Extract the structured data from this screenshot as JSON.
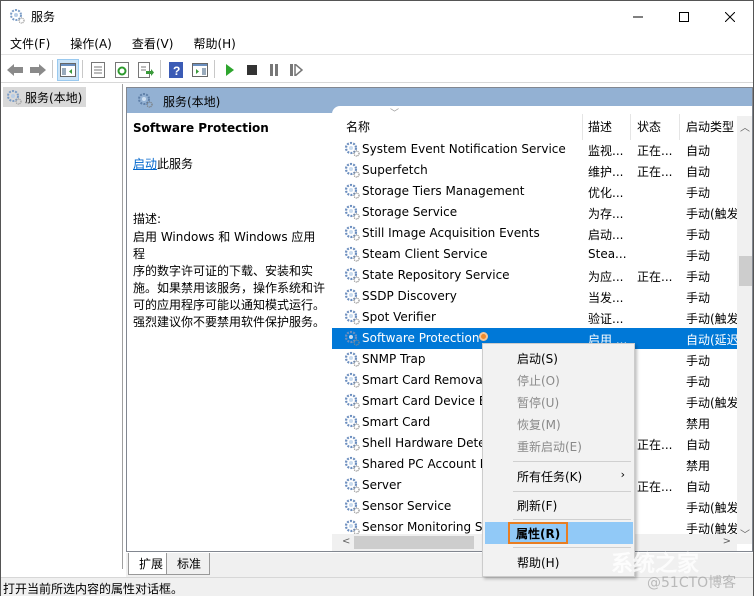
{
  "window": {
    "title": "服务",
    "app_icon": "gear-services-icon",
    "controls": {
      "minimize": "minimize-icon",
      "maximize": "maximize-icon",
      "close": "close-icon"
    }
  },
  "menubar": {
    "items": [
      "文件(F)",
      "操作(A)",
      "查看(V)",
      "帮助(H)"
    ]
  },
  "toolbar": {
    "buttons": [
      "back-icon",
      "forward-icon",
      "show-hide-tree-icon",
      "properties-icon",
      "refresh-icon",
      "export-list-icon",
      "help-icon",
      "show-hide-action-pane-icon",
      "start-service-icon",
      "stop-service-icon",
      "pause-service-icon",
      "restart-service-icon"
    ]
  },
  "tree": {
    "items": [
      {
        "label": "服务(本地)",
        "icon": "gear-services-icon",
        "selected": true
      }
    ]
  },
  "content": {
    "header": "服务(本地)",
    "description_pane": {
      "service_name": "Software Protection",
      "start_link": "启动",
      "start_suffix": "此服务",
      "desc_label": "描述:",
      "desc_lines": [
        "启用 Windows 和 Windows 应用程",
        "序的数字许可证的下载、安装和实",
        "施。如果禁用该服务，操作系统和许",
        "可的应用程序可能以通知模式运行。",
        "强烈建议你不要禁用软件保护服务。"
      ]
    },
    "list": {
      "columns": [
        "名称",
        "描述",
        "状态",
        "启动类型"
      ],
      "rows": [
        {
          "name": "System Event Notification Service",
          "desc": "监视...",
          "state": "正在...",
          "type": "自动"
        },
        {
          "name": "Superfetch",
          "desc": "维护...",
          "state": "正在...",
          "type": "自动"
        },
        {
          "name": "Storage Tiers Management",
          "desc": "优化...",
          "state": "",
          "type": "手动"
        },
        {
          "name": "Storage Service",
          "desc": "为存...",
          "state": "",
          "type": "手动(触发"
        },
        {
          "name": "Still Image Acquisition Events",
          "desc": "启动...",
          "state": "",
          "type": "手动"
        },
        {
          "name": "Steam Client Service",
          "desc": "Stea...",
          "state": "",
          "type": "手动"
        },
        {
          "name": "State Repository Service",
          "desc": "为应...",
          "state": "正在...",
          "type": "手动"
        },
        {
          "name": "SSDP Discovery",
          "desc": "当发...",
          "state": "",
          "type": "手动"
        },
        {
          "name": "Spot Verifier",
          "desc": "验证...",
          "state": "",
          "type": "手动(触发"
        },
        {
          "name": "Software Protection",
          "desc": "启用 ...",
          "state": "",
          "type": "自动(延迟",
          "selected": true
        },
        {
          "name": "SNMP Trap",
          "desc": "",
          "state": "",
          "type": "手动"
        },
        {
          "name": "Smart Card Removal",
          "desc": "",
          "state": "",
          "type": "手动"
        },
        {
          "name": "Smart Card Device E",
          "desc": "",
          "state": "",
          "type": "手动(触发"
        },
        {
          "name": "Smart Card",
          "desc": "",
          "state": "",
          "type": "禁用"
        },
        {
          "name": "Shell Hardware Dete",
          "desc": "",
          "state": "正在...",
          "type": "自动"
        },
        {
          "name": "Shared PC Account M",
          "desc": "",
          "state": "",
          "type": "禁用"
        },
        {
          "name": "Server",
          "desc": "",
          "state": "正在...",
          "type": "自动"
        },
        {
          "name": "Sensor Service",
          "desc": "",
          "state": "",
          "type": "手动(触发"
        },
        {
          "name": "Sensor Monitoring S",
          "desc": "",
          "state": "",
          "type": "手动(触发"
        }
      ]
    },
    "tabs": [
      "扩展",
      "标准"
    ]
  },
  "context_menu": {
    "items": [
      {
        "label": "启动(S)",
        "enabled": true
      },
      {
        "label": "停止(O)",
        "enabled": false
      },
      {
        "label": "暂停(U)",
        "enabled": false
      },
      {
        "label": "恢复(M)",
        "enabled": false
      },
      {
        "label": "重新启动(E)",
        "enabled": false
      },
      {
        "label": "所有任务(K)",
        "enabled": true,
        "submenu": true
      },
      {
        "label": "刷新(F)",
        "enabled": true
      },
      {
        "label": "属性(R)",
        "enabled": true,
        "highlighted": true
      },
      {
        "label": "帮助(H)",
        "enabled": true
      }
    ]
  },
  "statusbar": {
    "text": "打开当前所选内容的属性对话框。"
  },
  "watermark": {
    "line1": "系统之家",
    "line2": "@51CTO博客"
  },
  "colors": {
    "selection": "#0078d7",
    "header_band": "#93b1d3",
    "menu_highlight": "#91c9f7",
    "callout_border": "#e87d21",
    "link": "#0066cc"
  }
}
